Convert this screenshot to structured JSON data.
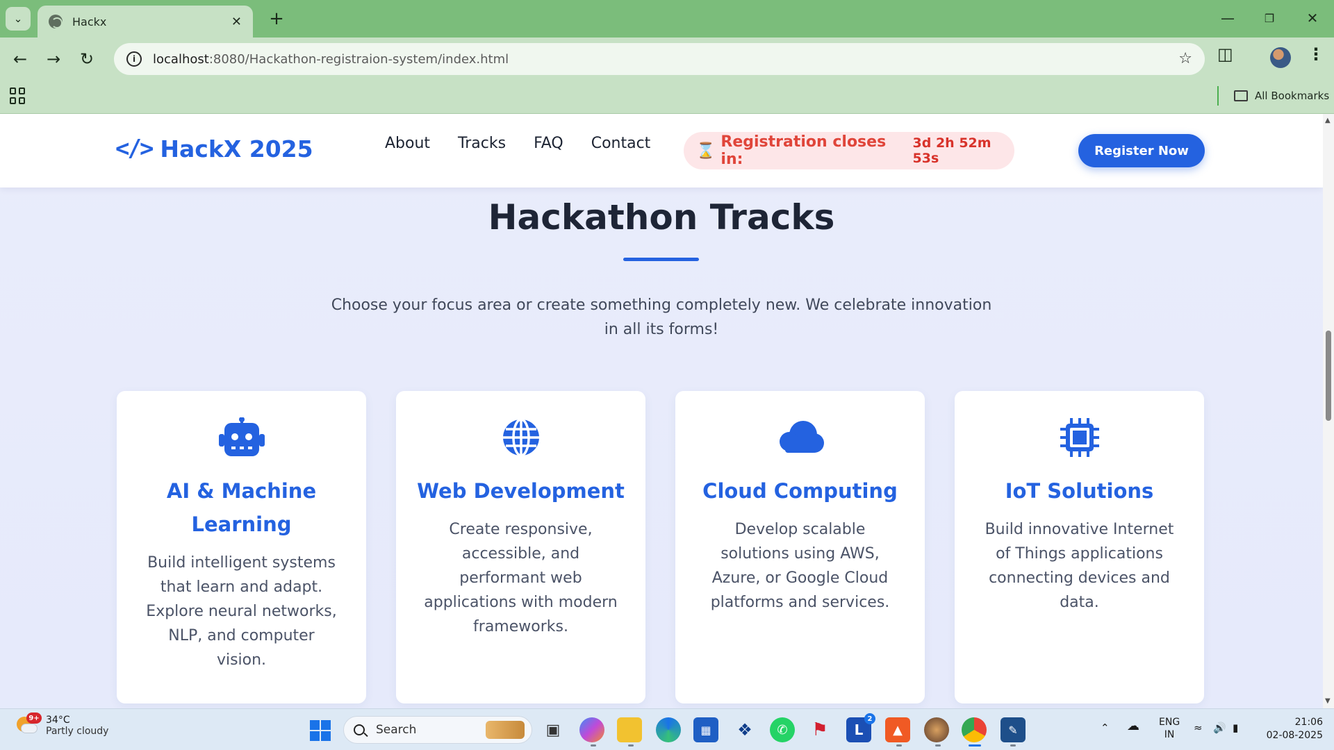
{
  "browser": {
    "tab_title": "Hackx",
    "url_host": "localhost",
    "url_path": ":8080/Hackathon-registraion-system/index.html",
    "all_bookmarks_label": "All Bookmarks"
  },
  "site": {
    "logo_code": "</>",
    "logo_text": "HackX 2025",
    "nav": [
      "About",
      "Tracks",
      "FAQ",
      "Contact"
    ],
    "countdown_label": "Registration closes in:",
    "countdown_time": "3d 2h 52m 53s",
    "register_label": "Register Now",
    "accent_color": "#2462e0",
    "countdown_color": "#e0453a"
  },
  "tracks": {
    "title": "Hackathon Tracks",
    "subtitle": "Choose your focus area or create something completely new. We celebrate innovation in all its forms!",
    "cards": [
      {
        "icon": "robot-icon",
        "title": "AI & Machine Learning",
        "description": "Build intelligent systems that learn and adapt. Explore neural networks, NLP, and computer vision."
      },
      {
        "icon": "globe-icon",
        "title": "Web Development",
        "description": "Create responsive, accessible, and performant web applications with modern frameworks."
      },
      {
        "icon": "cloud-icon",
        "title": "Cloud Computing",
        "description": "Develop scalable solutions using AWS, Azure, or Google Cloud platforms and services."
      },
      {
        "icon": "chip-icon",
        "title": "IoT Solutions",
        "description": "Build innovative Internet of Things applications connecting devices and data."
      }
    ]
  },
  "taskbar": {
    "weather_badge": "9+",
    "weather_temp": "34°C",
    "weather_condition": "Partly cloudy",
    "search_placeholder": "Search",
    "lang_line1": "ENG",
    "lang_line2": "IN",
    "time": "21:06",
    "date": "02-08-2025",
    "notification_count": "2"
  }
}
